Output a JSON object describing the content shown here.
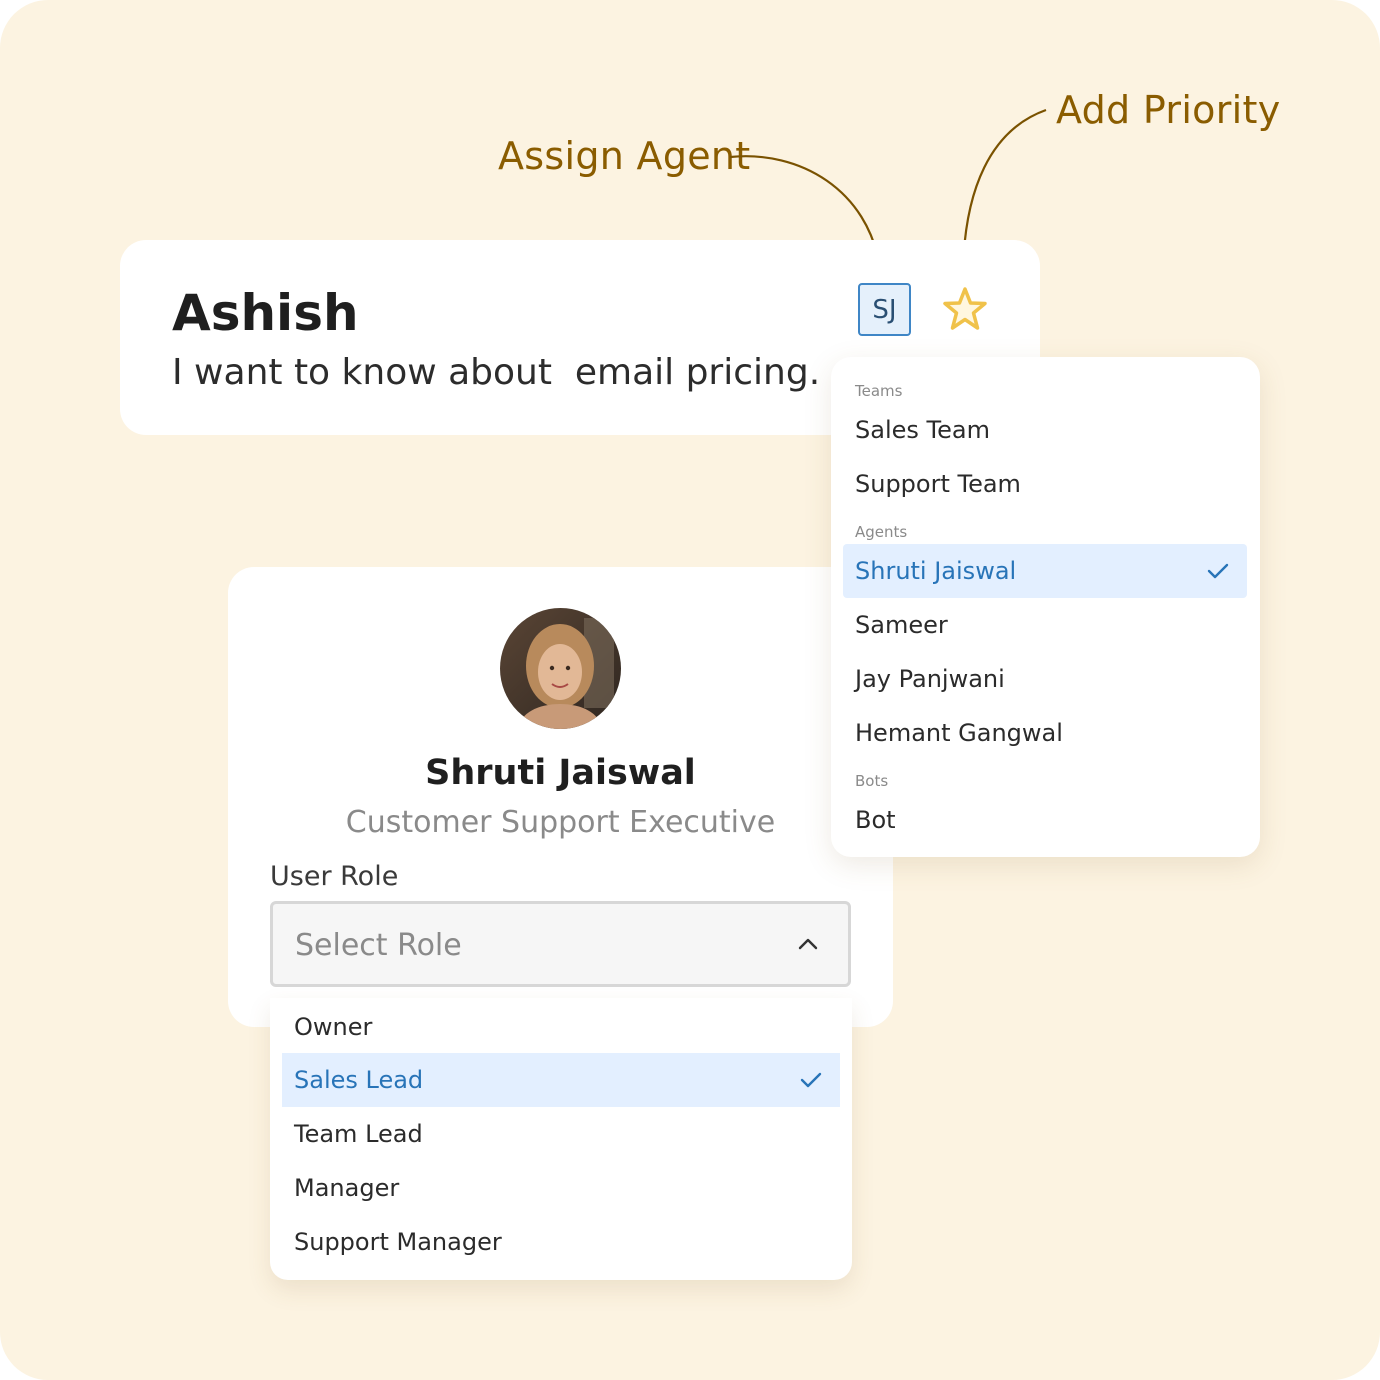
{
  "callouts": {
    "assign_agent": "Assign Agent",
    "add_priority": "Add Priority"
  },
  "conversation": {
    "contact_name": "Ashish",
    "message": "I want to know about  email pricing.",
    "assigned_agent_initials": "SJ",
    "priority_icon": "star-icon"
  },
  "assign_menu": {
    "groups": [
      {
        "label": "Teams",
        "items": [
          {
            "label": "Sales Team",
            "selected": false
          },
          {
            "label": "Support Team",
            "selected": false
          }
        ]
      },
      {
        "label": "Agents",
        "items": [
          {
            "label": "Shruti Jaiswal",
            "selected": true
          },
          {
            "label": "Sameer",
            "selected": false
          },
          {
            "label": "Jay Panjwani",
            "selected": false
          },
          {
            "label": "Hemant Gangwal",
            "selected": false
          }
        ]
      },
      {
        "label": "Bots",
        "items": [
          {
            "label": "Bot",
            "selected": false
          }
        ]
      }
    ]
  },
  "profile": {
    "name": "Shruti Jaiswal",
    "title": "Customer Support Executive",
    "role_label": "User Role",
    "role_placeholder": "Select Role"
  },
  "role_menu": {
    "options": [
      {
        "label": "Owner",
        "selected": false
      },
      {
        "label": "Sales Lead",
        "selected": true
      },
      {
        "label": "Team Lead",
        "selected": false
      },
      {
        "label": "Manager",
        "selected": false
      },
      {
        "label": "Support Manager",
        "selected": false
      }
    ]
  },
  "colors": {
    "background": "#fcf3e1",
    "callout": "#8a5c00",
    "accent_blue": "#2874b8",
    "selected_bg": "#e3efff",
    "star": "#f0c24a"
  }
}
